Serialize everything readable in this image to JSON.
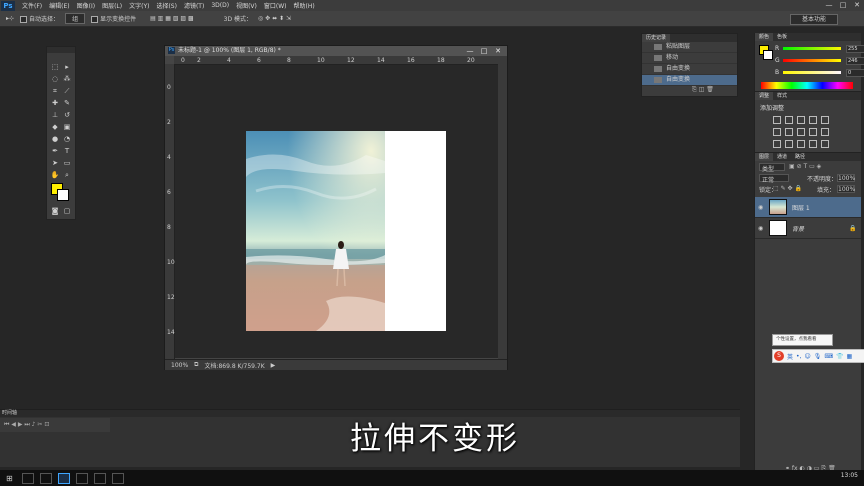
{
  "app": {
    "logo": "Ps"
  },
  "menu": [
    "文件(F)",
    "编辑(E)",
    "图像(I)",
    "图层(L)",
    "文字(Y)",
    "选择(S)",
    "滤镜(T)",
    "3D(D)",
    "视图(V)",
    "窗口(W)",
    "帮助(H)"
  ],
  "window_controls": {
    "minimize": "—",
    "maximize": "□",
    "close": "✕"
  },
  "options_bar": {
    "auto_select_label": "自动选择：",
    "auto_select_value": "组",
    "show_transform_label": "显示变换控件",
    "mode_3d_label": "3D 模式："
  },
  "workspace": {
    "label": "基本功能"
  },
  "document": {
    "title": "未标题-1 @ 100% (图层 1, RGB/8) *",
    "zoom": "100%",
    "doc_info": "文档:869.8 K/759.7K",
    "ruler_top": [
      "0",
      "2",
      "4",
      "6",
      "8",
      "10",
      "12",
      "14",
      "16",
      "18",
      "20"
    ],
    "ruler_left": [
      "0",
      "2",
      "4",
      "6",
      "8",
      "10",
      "12",
      "14"
    ]
  },
  "history_panel": {
    "tabs": [
      "历史记录"
    ],
    "items": [
      "粘贴图层",
      "移动",
      "自由变换",
      "自由变换"
    ]
  },
  "color_panel": {
    "tabs": [
      "颜色",
      "色板"
    ],
    "r": "255",
    "g": "246",
    "b": "0",
    "labels": {
      "r": "R",
      "g": "G",
      "b": "B"
    }
  },
  "adjust_panel": {
    "tabs": [
      "调整",
      "样式"
    ],
    "title": "添加调整"
  },
  "layers_panel": {
    "tabs": [
      "图层",
      "通道",
      "路径"
    ],
    "kind": "类型",
    "blend_mode": "正常",
    "opacity_label": "不透明度：",
    "opacity_value": "100%",
    "lock_label": "锁定：",
    "fill_label": "填充：",
    "fill_value": "100%",
    "layers": [
      {
        "name": "图层 1"
      },
      {
        "name": "背景"
      }
    ]
  },
  "tooltip": {
    "text": "个性设置，点我看看"
  },
  "ime": {
    "logo": "S",
    "mode": "英"
  },
  "timeline": {
    "label": "时间轴"
  },
  "subtitle": "拉伸不变形",
  "clock": "13:05",
  "colors": {
    "foreground": "#ffee00",
    "background": "#ffffff",
    "accent": "#4d6b8c"
  }
}
